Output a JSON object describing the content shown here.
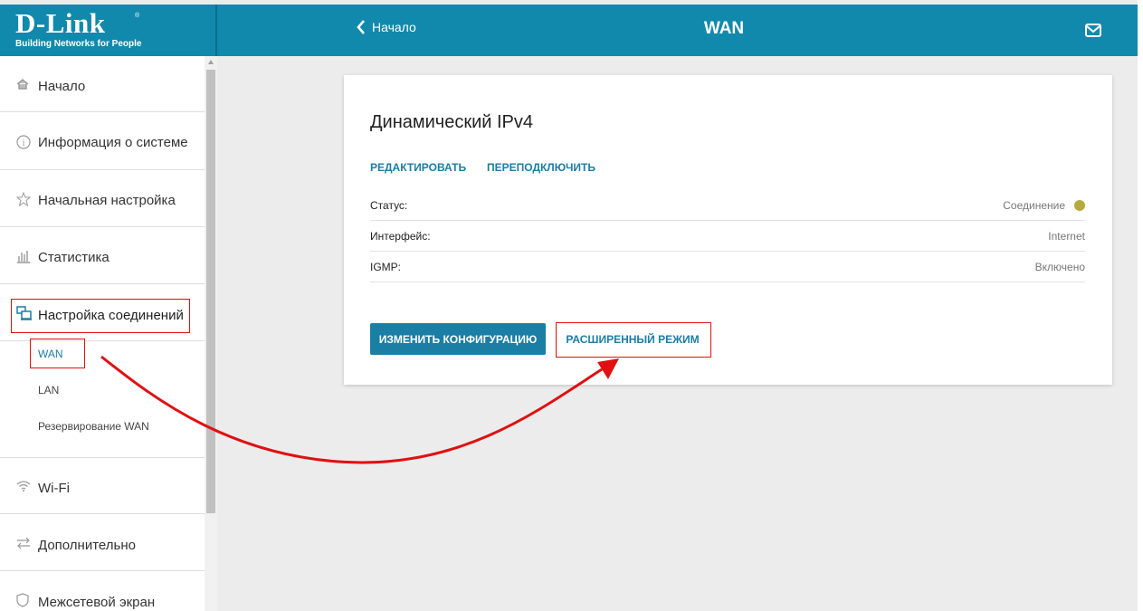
{
  "header": {
    "logo": "D-Link",
    "logo_tagline": "Building Networks for People",
    "back_label": "Начало",
    "title": "WAN"
  },
  "sidebar": {
    "items": [
      {
        "label": "Начало",
        "icon": "home-icon"
      },
      {
        "label": "Информация о системе",
        "icon": "info-icon"
      },
      {
        "label": "Начальная настройка",
        "icon": "star-icon"
      },
      {
        "label": "Статистика",
        "icon": "stats-icon"
      },
      {
        "label": "Настройка соединений",
        "icon": "connections-icon"
      },
      {
        "label": "Wi-Fi",
        "icon": "wifi-icon"
      },
      {
        "label": "Дополнительно",
        "icon": "arrows-icon"
      },
      {
        "label": "Межсетевой экран",
        "icon": "shield-icon"
      }
    ],
    "subitems": [
      {
        "label": "WAN",
        "active": true
      },
      {
        "label": "LAN",
        "active": false
      },
      {
        "label": "Резервирование WAN",
        "active": false
      }
    ]
  },
  "card": {
    "title": "Динамический IPv4",
    "links": {
      "edit": "РЕДАКТИРОВАТЬ",
      "reconnect": "ПЕРЕПОДКЛЮЧИТЬ"
    },
    "rows": [
      {
        "key": "Статус:",
        "value": "Соединение"
      },
      {
        "key": "Интерфейс:",
        "value": "Internet"
      },
      {
        "key": "IGMP:",
        "value": "Включено"
      }
    ],
    "buttons": {
      "change_config": "ИЗМЕНИТЬ КОНФИГУРАЦИЮ",
      "advanced": "РАСШИРЕННЫЙ РЕЖИМ"
    }
  },
  "colors": {
    "accent": "#1a7ea5",
    "header_bg": "#1189ac",
    "status_dot": "#b6a93d",
    "annotation": "#e01010"
  }
}
